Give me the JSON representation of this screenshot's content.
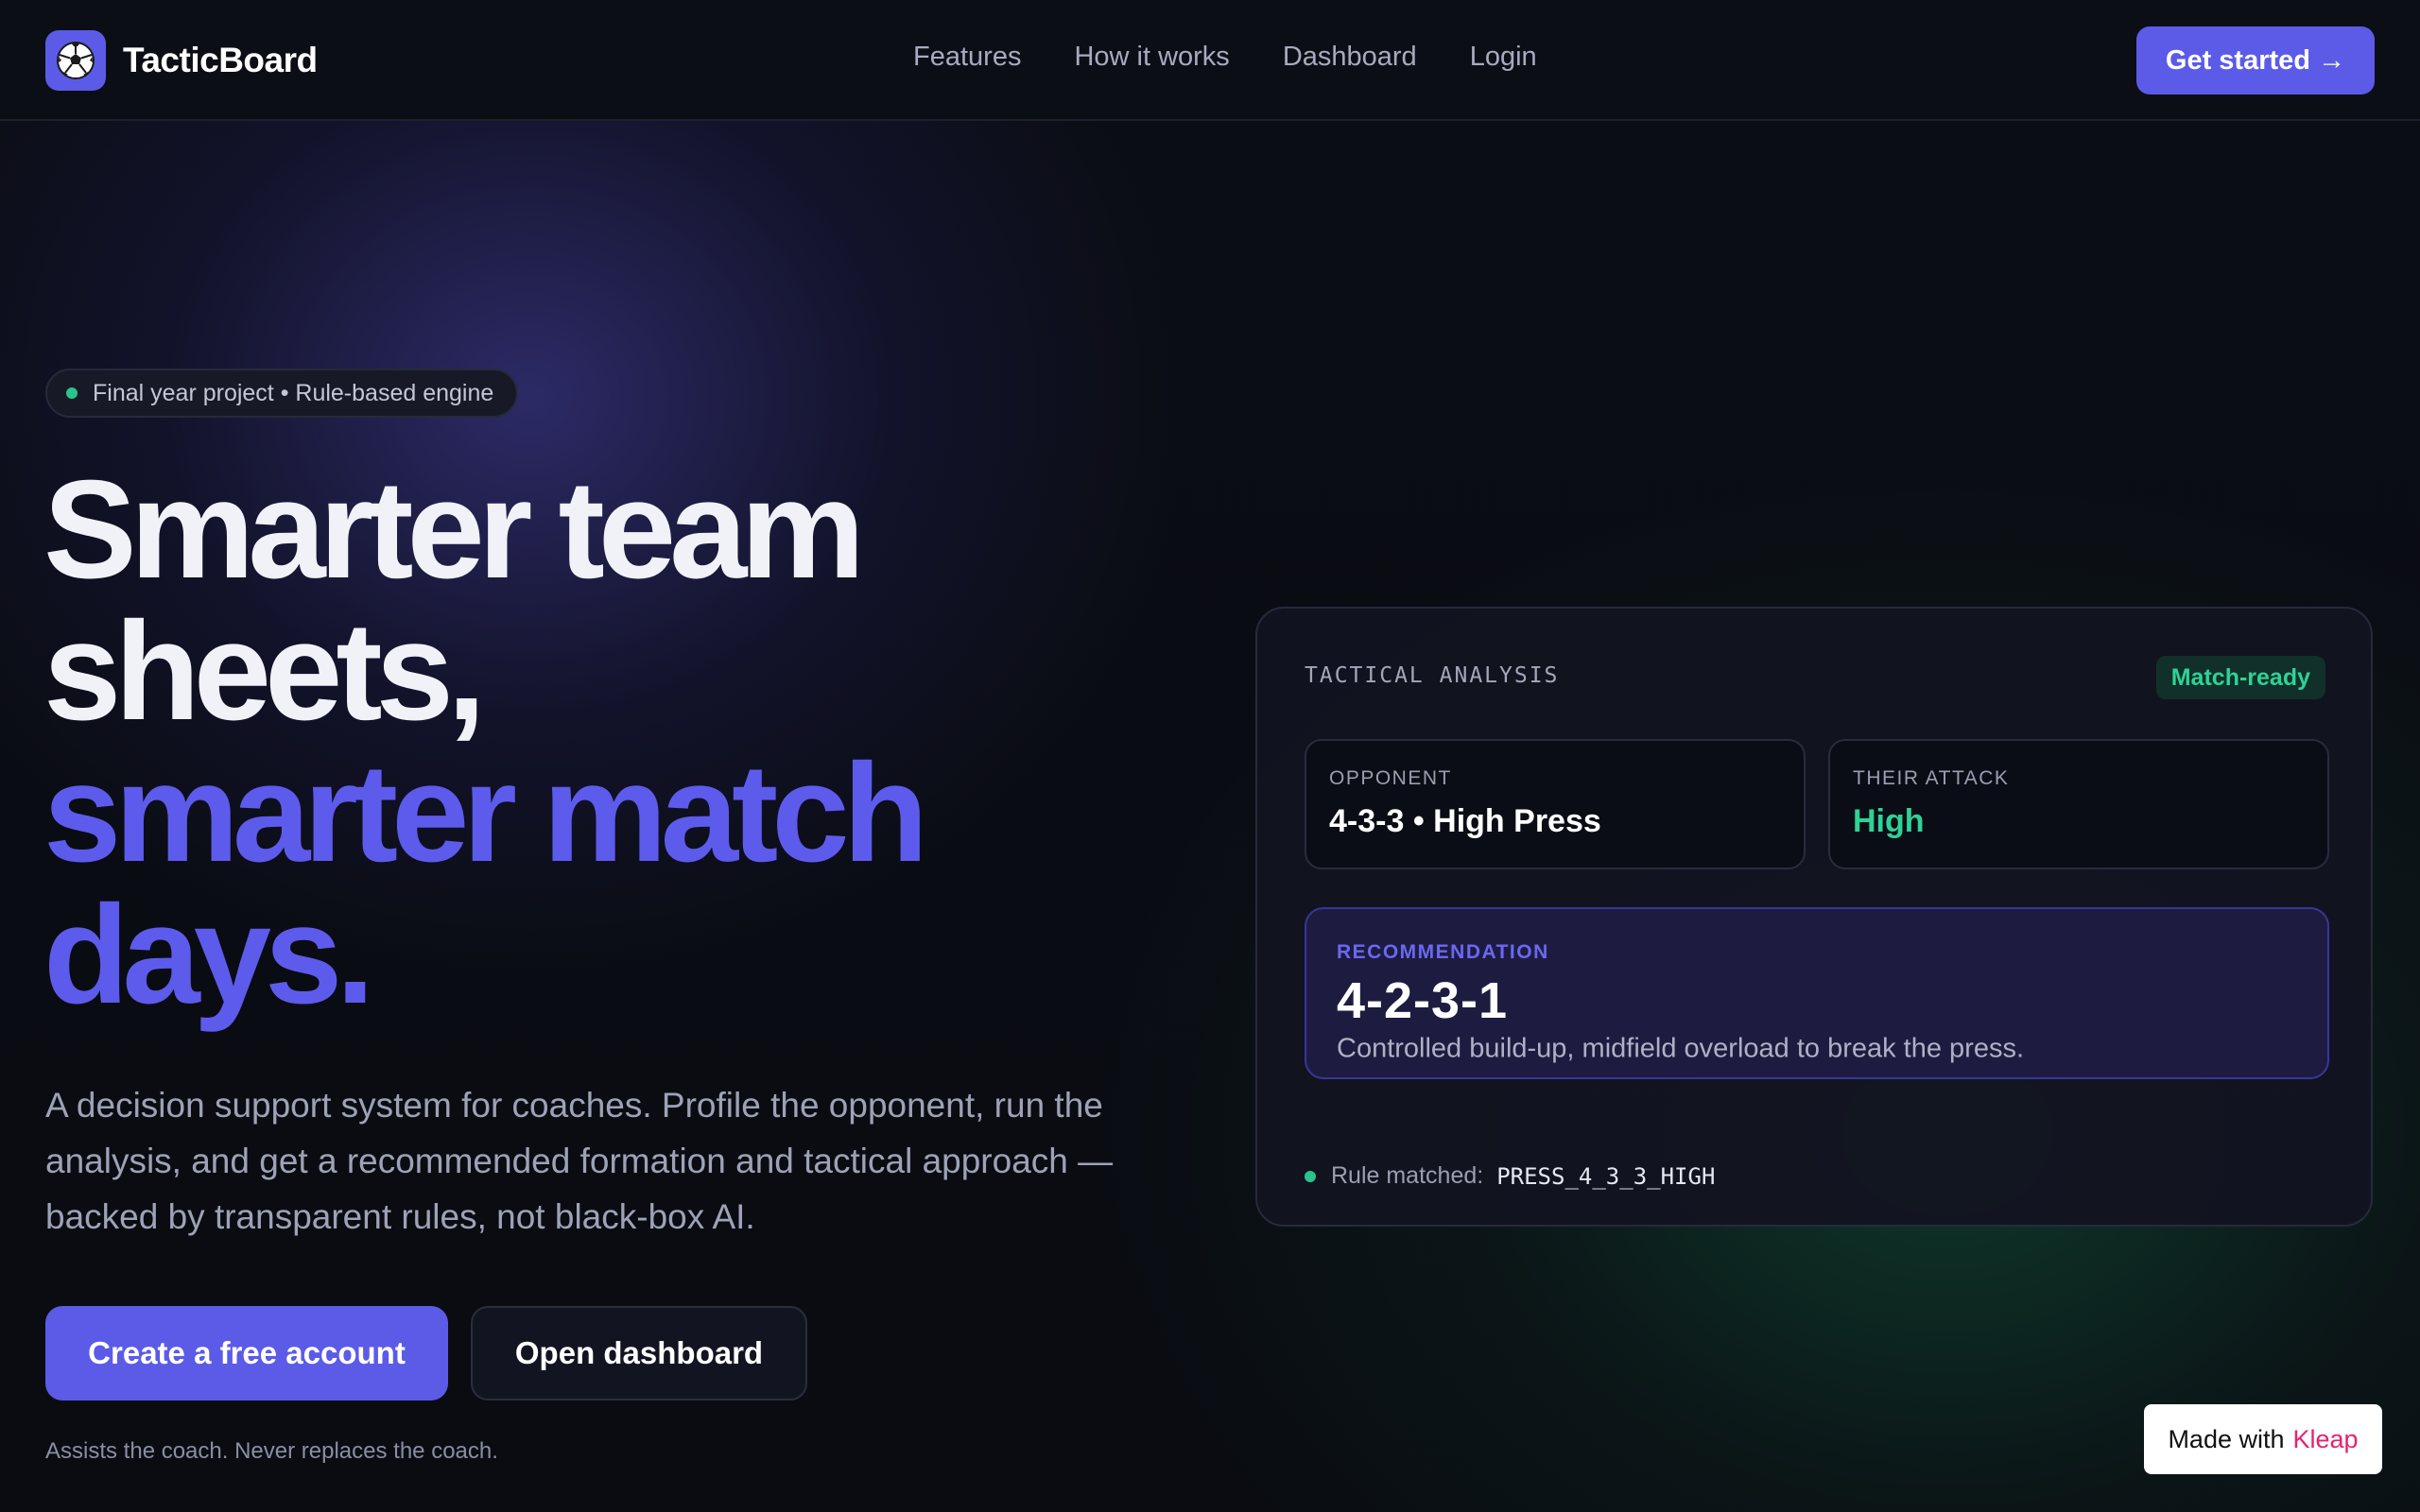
{
  "nav": {
    "brand": "TacticBoard",
    "links": [
      "Features",
      "How it works",
      "Dashboard",
      "Login"
    ],
    "cta": "Get started →",
    "logo_icon": "soccer-ball-icon"
  },
  "hero": {
    "pill": "Final year project • Rule-based engine",
    "headline_line1": "Smarter team sheets,",
    "headline_line2": "smarter match days.",
    "lead": "A decision support system for coaches. Profile the opponent, run the analysis, and get a recommended formation and tactical approach — backed by transparent rules, not black-box AI.",
    "primary_button": "Create a free account",
    "secondary_button": "Open dashboard",
    "note": "Assists the coach. Never replaces the coach."
  },
  "analysis_card": {
    "title": "TACTICAL ANALYSIS",
    "badge": "Match-ready",
    "opponent_label": "OPPONENT",
    "opponent_value": "4-3-3 • High Press",
    "attack_label": "THEIR ATTACK",
    "attack_value": "High",
    "recommendation_label": "RECOMMENDATION",
    "recommendation_value": "4-2-3-1",
    "recommendation_desc": "Controlled build-up, midfield overload to break the press.",
    "rule_label": "Rule matched:",
    "rule_code": "PRESS_4_3_3_HIGH"
  },
  "footer_badge": {
    "prefix": "Made with",
    "brand": "Kleap"
  },
  "colors": {
    "accent": "#5b5be8",
    "success": "#2fd296",
    "background": "#0b0d14"
  }
}
